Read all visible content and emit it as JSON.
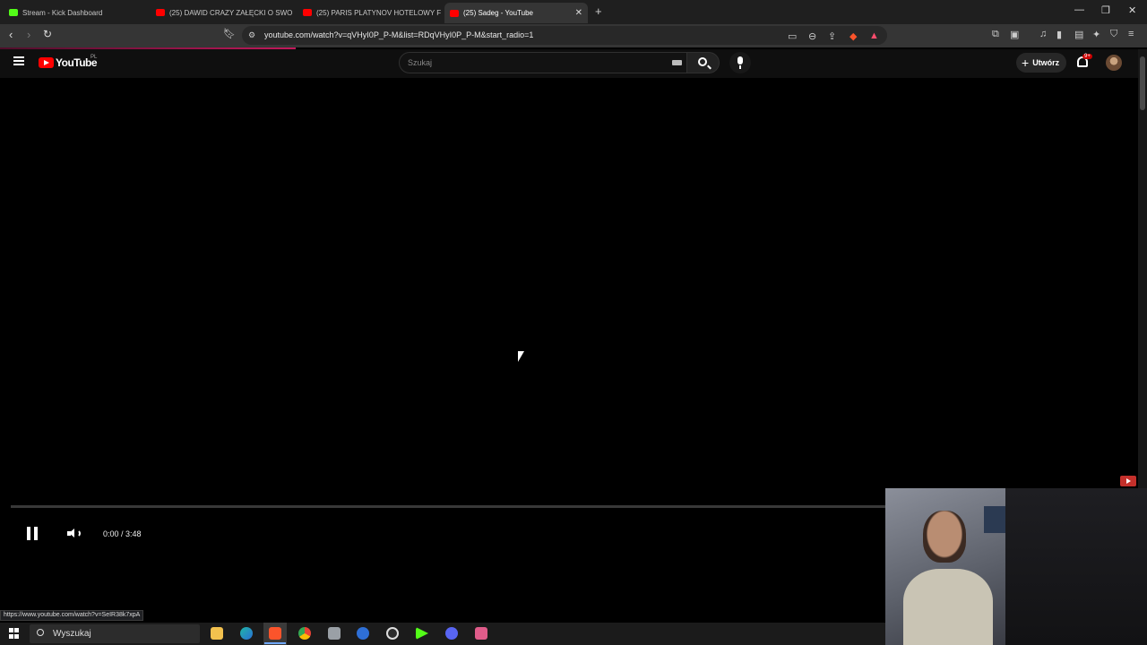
{
  "browser": {
    "tabs": [
      {
        "title": "Stream - Kick Dashboard",
        "favicon": "kick-icon"
      },
      {
        "title": "(25) DAWID CRAZY ZAŁĘCKI O SWO",
        "favicon": "youtube-icon"
      },
      {
        "title": "(25) PARIS PLATYNOV HOTELOWY FR",
        "favicon": "youtube-icon"
      },
      {
        "title": "(25) Sadeg - YouTube",
        "favicon": "youtube-icon",
        "active": true
      }
    ],
    "new_tab": "+",
    "url": "youtube.com/watch?v=qVHyI0P_P-M&list=RDqVHyI0P_P-M&start_radio=1"
  },
  "youtube": {
    "logo_text": "YouTube",
    "country_code": "PL",
    "search_placeholder": "Szukaj",
    "create_label": "Utwórz",
    "notifications_badge": "9+"
  },
  "player": {
    "time": "0:00 / 3:48",
    "state": "playing",
    "progress": 0
  },
  "status_bar_url": "https://www.youtube.com/watch?v=SeIR38k7xpA",
  "taskbar": {
    "search_label": "Wyszukaj",
    "apps": [
      "file-explorer-icon",
      "edge-icon",
      "brave-icon",
      "chrome-icon",
      "app-icon",
      "ccleaner-icon",
      "obs-icon",
      "play-icon",
      "discord-icon",
      "app-icon-2"
    ]
  },
  "colors": {
    "youtube_red": "#ff0000",
    "kick_green": "#53fc18",
    "background": "#000000"
  }
}
